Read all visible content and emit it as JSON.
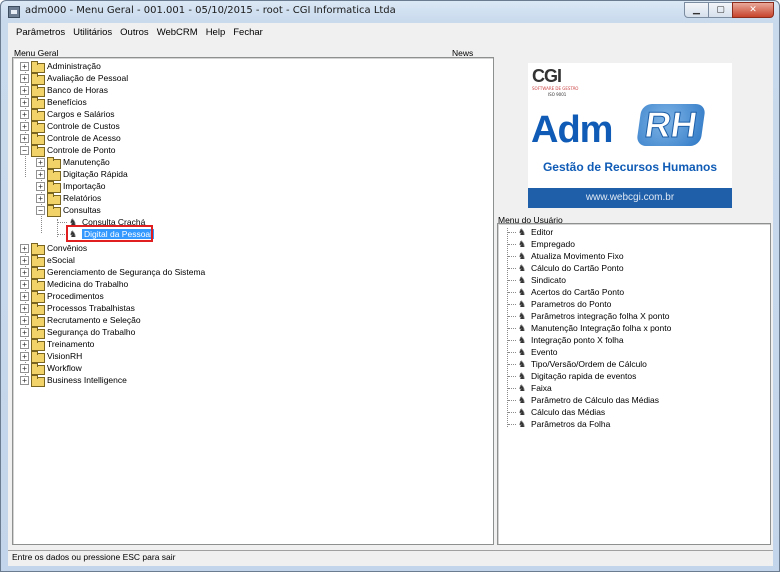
{
  "window": {
    "title": "adm000 - Menu Geral - 001.001 - 05/10/2015 - root - CGI Informatica Ltda",
    "minimize": "▁",
    "maximize": "▢",
    "close": "✕"
  },
  "menubar": [
    {
      "label": "Parâmetros"
    },
    {
      "label": "Utilitários"
    },
    {
      "label": "Outros"
    },
    {
      "label": "WebCRM"
    },
    {
      "label": "Help"
    },
    {
      "label": "Fechar"
    }
  ],
  "labels": {
    "menu_geral": "Menu Geral",
    "news": "News",
    "menu_usuario": "Menu do Usuário"
  },
  "tree": {
    "top": [
      {
        "label": "Administração",
        "state": "+"
      },
      {
        "label": "Avaliação de Pessoal",
        "state": "+"
      },
      {
        "label": "Banco de Horas",
        "state": "+"
      },
      {
        "label": "Benefícios",
        "state": "+"
      },
      {
        "label": "Cargos e Salários",
        "state": "+"
      },
      {
        "label": "Controle de Custos",
        "state": "+"
      },
      {
        "label": "Controle de Acesso",
        "state": "+"
      },
      {
        "label": "Controle de Ponto",
        "state": "−"
      }
    ],
    "ponto_children": [
      {
        "label": "Manutenção",
        "state": "+"
      },
      {
        "label": "Digitação Rápida",
        "state": "+"
      },
      {
        "label": "Importação",
        "state": "+"
      },
      {
        "label": "Relatórios",
        "state": "+"
      },
      {
        "label": "Consultas",
        "state": "−"
      }
    ],
    "consultas_children": [
      {
        "label": "Consulta Crachá"
      },
      {
        "label": "Digital da Pessoal"
      }
    ],
    "bottom": [
      {
        "label": "Convênios",
        "state": "+"
      },
      {
        "label": "eSocial",
        "state": "+"
      },
      {
        "label": "Gerenciamento de Segurança do Sistema",
        "state": "+"
      },
      {
        "label": "Medicina do Trabalho",
        "state": "+"
      },
      {
        "label": "Procedimentos",
        "state": "+"
      },
      {
        "label": "Processos Trabalhistas",
        "state": "+"
      },
      {
        "label": "Recrutamento e Seleção",
        "state": "+"
      },
      {
        "label": "Segurança do Trabalho",
        "state": "+"
      },
      {
        "label": "Treinamento",
        "state": "+"
      },
      {
        "label": "VisionRH",
        "state": "+"
      },
      {
        "label": "Workflow",
        "state": "+"
      },
      {
        "label": "Business Intelligence",
        "state": "+"
      }
    ]
  },
  "logo": {
    "brand": "CGI",
    "brand_sub": "SOFTWARE DE GESTÃO",
    "iso": "ISO 9001",
    "adm": "Adm",
    "rh": "RH",
    "slogan": "Gestão de Recursos Humanos",
    "website": "www.webcgi.com.br"
  },
  "user_menu": [
    "Editor",
    "Empregado",
    "Atualiza Movimento Fixo",
    "Cálculo do Cartão Ponto",
    "Sindicato",
    "Acertos do Cartão Ponto",
    "Parametros do Ponto",
    "Parâmetros integração folha X ponto",
    "Manutenção Integração folha x ponto",
    "Integração ponto X folha",
    "Evento",
    "Tipo/Versão/Ordem de Cálculo",
    "Digitação rapida de eventos",
    "Faixa",
    "Parâmetro de Cálculo das Médias",
    "Cálculo das Médias",
    "Parâmetros da Folha"
  ],
  "status": "Entre os dados ou pressione ESC para sair",
  "colors": {
    "selection": "#3399ff",
    "annotation_box": "#e02020",
    "folder": "#f1d36a",
    "brand_blue": "#0f5bb5"
  }
}
